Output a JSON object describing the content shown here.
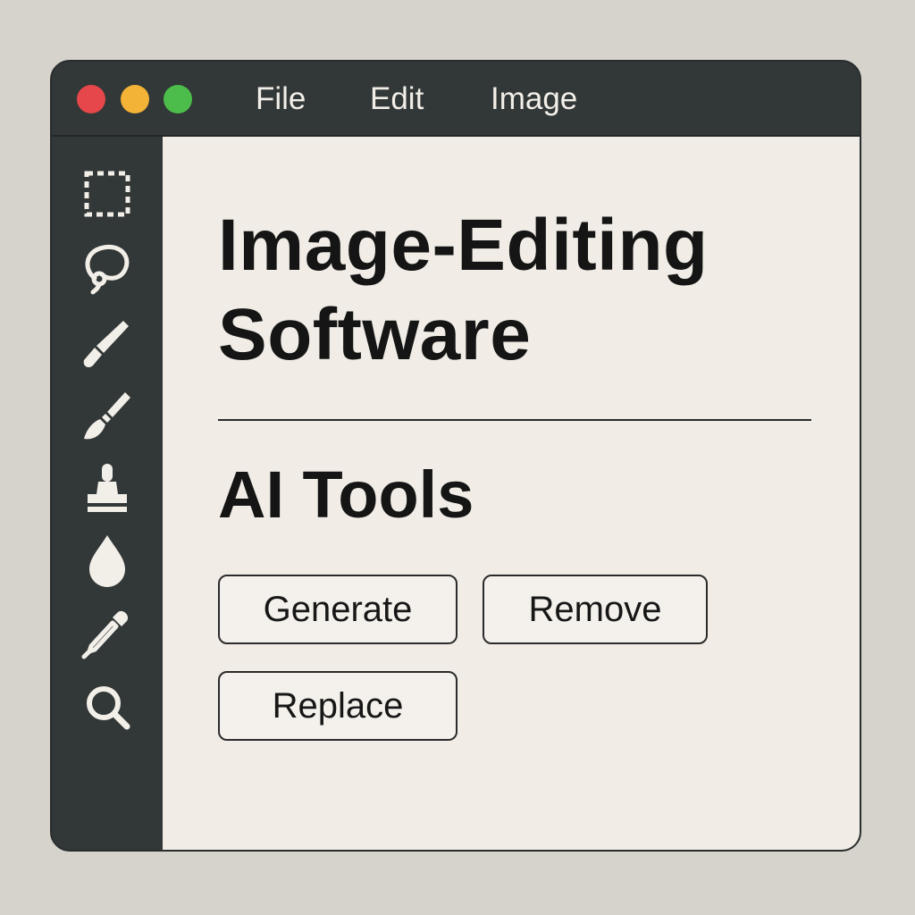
{
  "window": {
    "controls": [
      "close",
      "minimize",
      "maximize"
    ]
  },
  "menu": {
    "items": [
      {
        "label": "File"
      },
      {
        "label": "Edit"
      },
      {
        "label": "Image"
      }
    ]
  },
  "toolbar": {
    "tools": [
      {
        "icon": "marquee-select-icon"
      },
      {
        "icon": "lasso-icon"
      },
      {
        "icon": "brush-icon"
      },
      {
        "icon": "paintbrush-icon"
      },
      {
        "icon": "stamp-icon"
      },
      {
        "icon": "drop-icon"
      },
      {
        "icon": "eyedropper-icon"
      },
      {
        "icon": "zoom-icon"
      }
    ]
  },
  "main": {
    "title_line1": "Image-Editing",
    "title_line2": "Software",
    "section_title": "AI Tools",
    "buttons": {
      "generate": "Generate",
      "remove": "Remove",
      "replace": "Replace"
    }
  },
  "colors": {
    "chrome": "#323737",
    "canvas": "#f1ede6",
    "close": "#e5474a",
    "minimize": "#f2b336",
    "maximize": "#4cbd4a"
  }
}
